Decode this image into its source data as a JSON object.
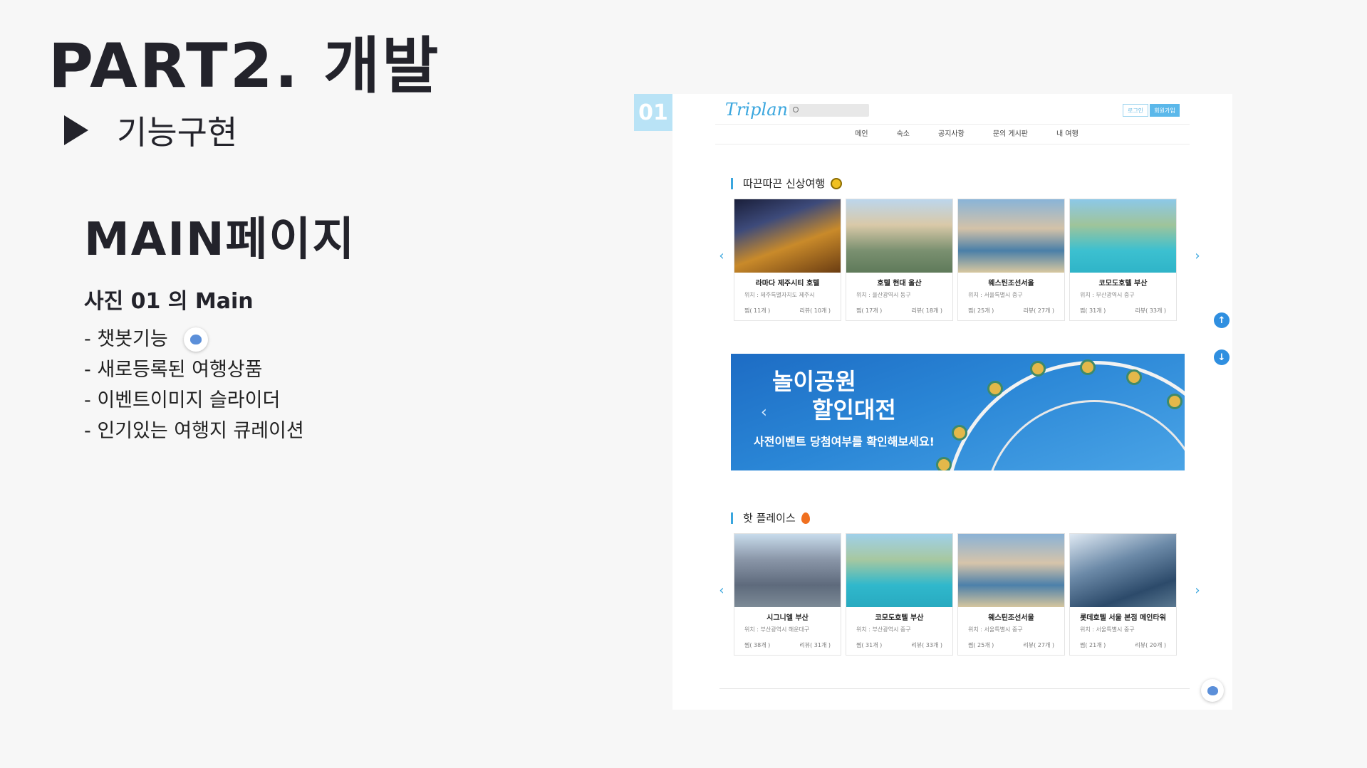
{
  "slide": {
    "part_title": "PART2. 개발",
    "subtitle": "기능구현",
    "main_title": "MAIN페이지",
    "photo_title": "사진 01 의 Main",
    "features": [
      "- 챗봇기능",
      "- 새로등록된 여행상품",
      "- 이벤트이미지 슬라이더",
      "- 인기있는 여행지 큐레이션"
    ],
    "badge": "01"
  },
  "site": {
    "logo": "Triplan",
    "login_label": "로그인",
    "join_label": "회원가입",
    "nav": [
      "메인",
      "숙소",
      "공지사항",
      "문의 게시판",
      "내 여행"
    ],
    "section1_title": "따끈따끈 신상여행",
    "section2_title": "핫 플레이스",
    "new_trips": [
      {
        "name": "라마다 제주시티 호텔",
        "loc": "위치 : 제주특별자치도 제주시",
        "likes": "찜( 11개 )",
        "reviews": "리뷰( 10개 )"
      },
      {
        "name": "호텔 현대 울산",
        "loc": "위치 : 울산광역시 동구",
        "likes": "찜( 17개 )",
        "reviews": "리뷰( 18개 )"
      },
      {
        "name": "웨스틴조선서울",
        "loc": "위치 : 서울특별시 중구",
        "likes": "찜( 25개 )",
        "reviews": "리뷰( 27개 )"
      },
      {
        "name": "코모도호텔 부산",
        "loc": "위치 : 부산광역시 중구",
        "likes": "찜( 31개 )",
        "reviews": "리뷰( 33개 )"
      }
    ],
    "hot_places": [
      {
        "name": "시그니엘 부산",
        "loc": "위치 : 부산광역시 해운대구",
        "likes": "찜( 38개 )",
        "reviews": "리뷰( 31개 )"
      },
      {
        "name": "코모도호텔 부산",
        "loc": "위치 : 부산광역시 중구",
        "likes": "찜( 31개 )",
        "reviews": "리뷰( 33개 )"
      },
      {
        "name": "웨스틴조선서울",
        "loc": "위치 : 서울특별시 중구",
        "likes": "찜( 25개 )",
        "reviews": "리뷰( 27개 )"
      },
      {
        "name": "롯데호텔 서울 본점 메인타워",
        "loc": "위치 : 서울특별시 중구",
        "likes": "찜( 21개 )",
        "reviews": "리뷰( 20개 )"
      }
    ],
    "banner": {
      "line1": "놀이공원",
      "line2": "할인대전",
      "line3": "사전이벤트  당첨여부를  확인해보세요!"
    },
    "icons": {
      "prev": "‹",
      "next": "›",
      "up": "↑",
      "down": "↓"
    },
    "accent_color": "#3aa6de"
  }
}
